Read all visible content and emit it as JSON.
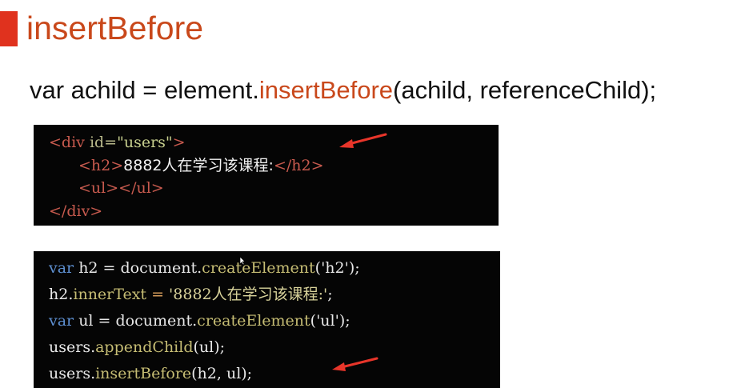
{
  "slide": {
    "title": "insertBefore",
    "syntax": {
      "prefix": "var achild = element.",
      "method": "insertBefore",
      "suffix": "(achild, referenceChild);"
    }
  },
  "html_code": {
    "line1": {
      "open": "<div ",
      "attr": "id=",
      "value": "\"users\"",
      "close": ">"
    },
    "line2": {
      "open": "<h2>",
      "text": "8882人在学习该课程:",
      "close": "</h2>"
    },
    "line3": {
      "tags": "<ul></ul>"
    },
    "line4": {
      "tag": "</div>"
    }
  },
  "js_code": {
    "line1": {
      "kw": "var",
      "name": " h2 = document.",
      "fn": "createElement",
      "args": "('h2');"
    },
    "line2": {
      "obj": "h2.",
      "prop": "innerText",
      "op": " = ",
      "str": "'8882人在学习该课程:'",
      "end": ";"
    },
    "line3": {
      "kw": "var",
      "name": " ul = document.",
      "fn": "createElement",
      "args": "('ul');"
    },
    "line4": {
      "obj": "users.",
      "fn": "appendChild",
      "args": "(ul);"
    },
    "line5": {
      "obj": "users.",
      "fn": "insertBefore",
      "args": "(h2, ul);"
    }
  },
  "colors": {
    "accent_bar": "#e0321e",
    "title": "#c9481b",
    "arrow": "#e8352a",
    "code_background": "#050505"
  },
  "icons": [
    "arrow-annotation-icon",
    "mouse-cursor-icon"
  ]
}
